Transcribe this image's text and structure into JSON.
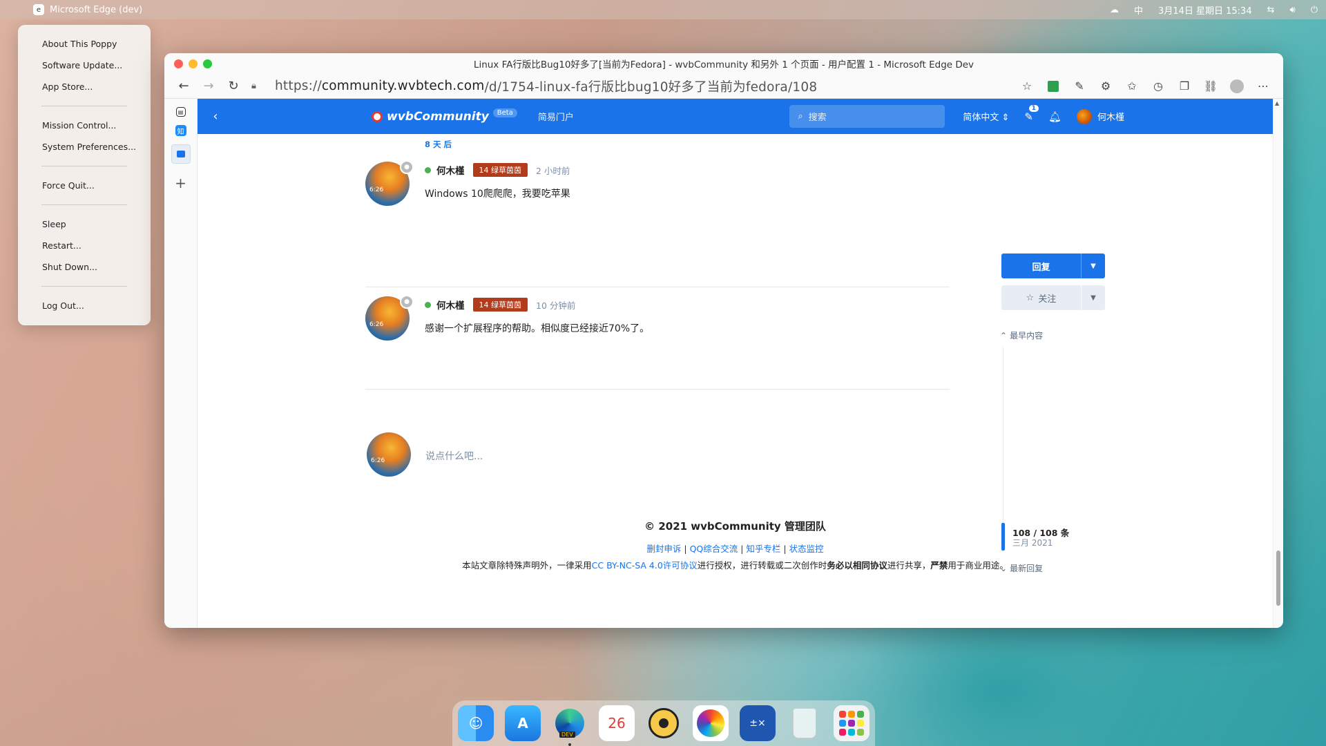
{
  "menubar": {
    "app_name": "Microsoft Edge (dev)",
    "input_method": "中",
    "datetime": "3月14日 星期日 15:34"
  },
  "apple_menu": {
    "items": [
      "About This Poppy",
      "Software Update...",
      "App Store...",
      "Mission Control...",
      "System Preferences...",
      "Force Quit...",
      "Sleep",
      "Restart...",
      "Shut Down...",
      "Log Out..."
    ]
  },
  "browser": {
    "window_title": "Linux FA行版比Bug10好多了[当前为Fedora] - wvbCommunity 和另外 1 个页面 - 用户配置 1 - Microsoft Edge Dev",
    "url": {
      "scheme": "https://",
      "host": "community.wvbtech.com",
      "path": "/d/1754-linux-fa行版比bug10好多了当前为fedora/108"
    }
  },
  "site": {
    "logo": "wvbCommunity",
    "beta": "Beta",
    "nav_link": "简易门户",
    "search_placeholder": "搜索",
    "language": "简体中文",
    "notif_count": "1",
    "username": "何木槿"
  },
  "thread": {
    "time_gap": "8 天 后",
    "posts": [
      {
        "author": "何木槿",
        "badge": "14 绿草茵茵",
        "time": "2 小时前",
        "body": "Windows 10爬爬爬，我要吃苹果",
        "avatar_clock": "6:26"
      },
      {
        "author": "何木槿",
        "badge": "14 绿草茵茵",
        "time": "10 分钟前",
        "body": "感谢一个扩展程序的帮助。相似度已经接近70%了。",
        "avatar_clock": "6:26"
      }
    ],
    "reply_placeholder": "说点什么吧..."
  },
  "sidebar_controls": {
    "reply": "回复",
    "follow": "关注",
    "earliest": "最早内容",
    "count": "108 / 108 条",
    "date": "三月 2021",
    "latest": "最新回复"
  },
  "footer": {
    "title": "© 2021 wvbCommunity 管理团队",
    "links": [
      "删封申诉",
      "QQ综合交流",
      "知乎专栏",
      "状态监控"
    ],
    "license_pre": "本站文章除特殊声明外，一律采用",
    "license_link": "CC BY-NC-SA 4.0许可协议",
    "license_mid": "进行授权，进行转载或二次创作时",
    "license_bold1": "务必以相同协议",
    "license_mid2": "进行共享，",
    "license_bold2": "严禁",
    "license_post": "用于商业用途。"
  },
  "dock": {
    "calendar_day": "26"
  },
  "colors": {
    "accent": "#1a73e8",
    "badge": "#b23b1b"
  }
}
